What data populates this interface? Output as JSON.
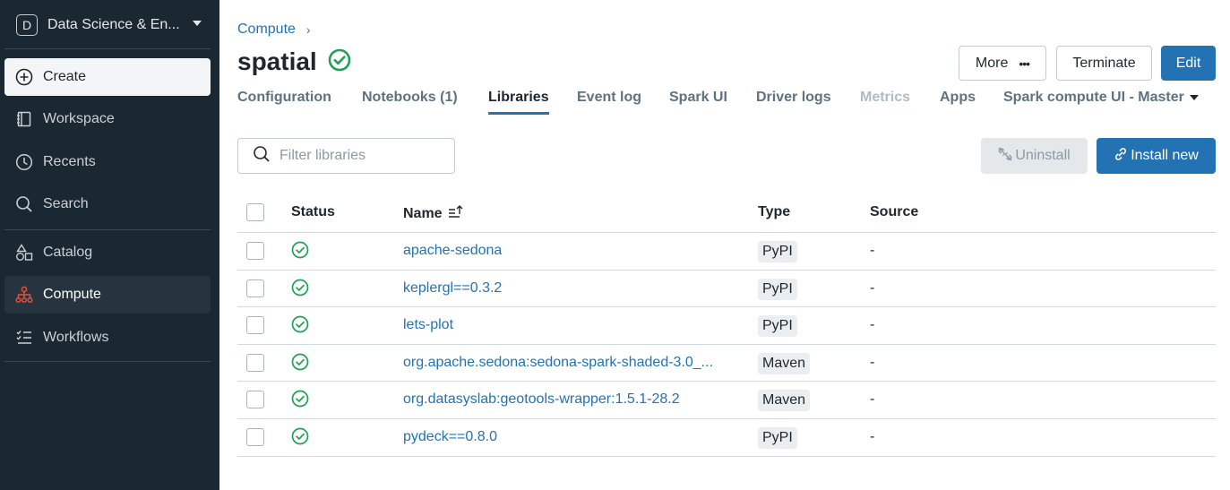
{
  "sidebar": {
    "workspace_badge": "D",
    "workspace_name": "Data Science & En...",
    "create_label": "Create",
    "items": [
      {
        "label": "Workspace"
      },
      {
        "label": "Recents"
      },
      {
        "label": "Search"
      },
      {
        "label": "Catalog"
      },
      {
        "label": "Compute"
      },
      {
        "label": "Workflows"
      }
    ]
  },
  "breadcrumb": {
    "parent": "Compute",
    "separator": "›"
  },
  "page": {
    "title": "spatial",
    "status_icon": "check-circle-icon"
  },
  "header_buttons": {
    "more": "More",
    "more_icon": "•••",
    "terminate": "Terminate",
    "edit": "Edit"
  },
  "tabs": [
    {
      "label": "Configuration"
    },
    {
      "label": "Notebooks (1)"
    },
    {
      "label": "Libraries"
    },
    {
      "label": "Event log"
    },
    {
      "label": "Spark UI"
    },
    {
      "label": "Driver logs"
    },
    {
      "label": "Metrics"
    },
    {
      "label": "Apps"
    },
    {
      "label": "Spark compute UI - Master"
    }
  ],
  "toolbar": {
    "filter_placeholder": "Filter libraries",
    "uninstall": "Uninstall",
    "install_new": "Install new"
  },
  "table": {
    "headers": {
      "status": "Status",
      "name": "Name",
      "type": "Type",
      "source": "Source"
    },
    "rows": [
      {
        "name": "apache-sedona",
        "type": "PyPI",
        "source": "-"
      },
      {
        "name": "keplergl==0.3.2",
        "type": "PyPI",
        "source": "-"
      },
      {
        "name": "lets-plot",
        "type": "PyPI",
        "source": "-"
      },
      {
        "name": "org.apache.sedona:sedona-spark-shaded-3.0_...",
        "type": "Maven",
        "source": "-"
      },
      {
        "name": "org.datasyslab:geotools-wrapper:1.5.1-28.2",
        "type": "Maven",
        "source": "-"
      },
      {
        "name": "pydeck==0.8.0",
        "type": "PyPI",
        "source": "-"
      }
    ]
  },
  "colors": {
    "accent": "#2272b4",
    "sidebar_bg": "#1b2731",
    "success": "#20a155",
    "compute_icon": "#e8503a"
  }
}
